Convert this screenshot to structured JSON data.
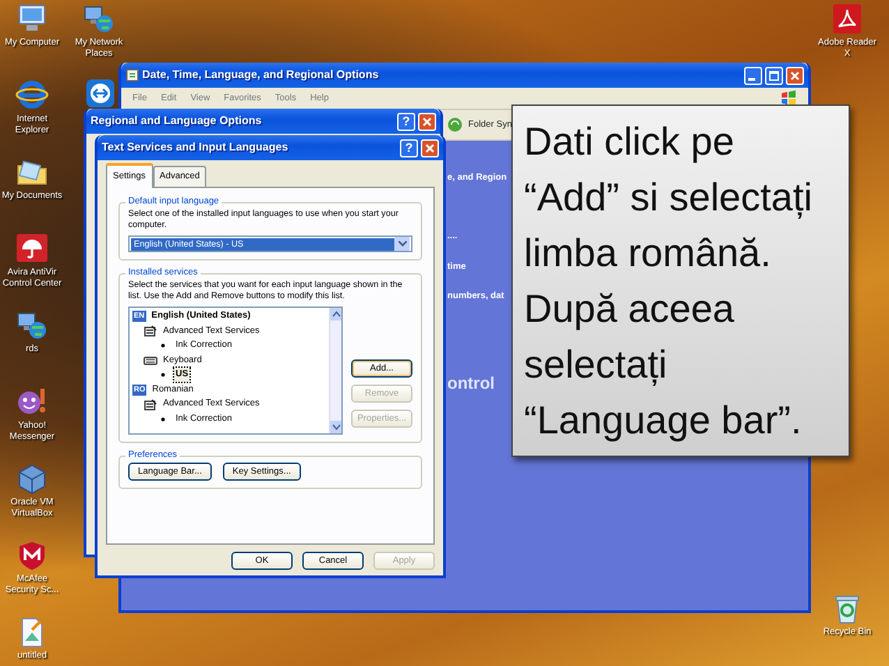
{
  "desktop": {
    "left_icons": [
      {
        "label": "My Computer",
        "kind": "computer"
      },
      {
        "label": "Internet Explorer",
        "kind": "browser"
      },
      {
        "label": "My Documents",
        "kind": "documents"
      },
      {
        "label": "Avira AntiVir Control Center",
        "kind": "avira"
      },
      {
        "label": "rds",
        "kind": "network"
      },
      {
        "label": "Yahoo! Messenger",
        "kind": "messenger"
      },
      {
        "label": "Oracle VM VirtualBox",
        "kind": "virtualbox"
      },
      {
        "label": "McAfee Security Sc...",
        "kind": "security"
      },
      {
        "label": "untitled",
        "kind": "image"
      }
    ],
    "second_icons": [
      {
        "label": "My Network Places",
        "kind": "network"
      },
      {
        "kind": "remote"
      }
    ],
    "right_icons": [
      {
        "label": "Adobe Reader X",
        "kind": "pdf"
      },
      {
        "label": "Recycle Bin",
        "kind": "recycle"
      }
    ]
  },
  "back_window": {
    "title": "Date, Time, Language, and Regional Options",
    "menu": [
      "File",
      "Edit",
      "View",
      "Favorites",
      "Tools",
      "Help"
    ],
    "toolbar_item": "Folder Syn",
    "panel_texts": [
      {
        "text": "e, and Region",
        "kind": "header"
      },
      {
        "text": "....",
        "kind": "task"
      },
      {
        "text": "time",
        "kind": "task"
      },
      {
        "text": "numbers, dat",
        "kind": "task"
      },
      {
        "text": "ontrol",
        "kind": "title"
      }
    ]
  },
  "regional_dialog": {
    "title": "Regional and Language Options",
    "help": "?"
  },
  "text_services_dialog": {
    "title": "Text Services and Input Languages",
    "help": "?",
    "tabs": [
      {
        "label": "Settings",
        "selected": true
      },
      {
        "label": "Advanced",
        "selected": false
      }
    ],
    "default_language": {
      "heading": "Default input language",
      "description": "Select one of the installed input languages to use when you start your computer.",
      "value": "English (United States) - US"
    },
    "installed_services": {
      "heading": "Installed services",
      "description": "Select the services that you want for each input language shown in the list. Use the Add and Remove buttons to modify this list.",
      "tree": [
        {
          "kind": "language",
          "badge": "EN",
          "label": "English (United States)",
          "default": true,
          "selected": false,
          "children": [
            {
              "kind": "services",
              "label": "Advanced Text Services",
              "selected": false,
              "children": [
                {
                  "kind": "item",
                  "label": "Ink Correction",
                  "selected": false
                }
              ]
            },
            {
              "kind": "keyboard",
              "label": "Keyboard",
              "selected": false,
              "children": [
                {
                  "kind": "item",
                  "label": "US",
                  "selected": true
                }
              ]
            }
          ]
        },
        {
          "kind": "language",
          "badge": "RO",
          "label": "Romanian",
          "default": false,
          "selected": false,
          "children": [
            {
              "kind": "services",
              "label": "Advanced Text Services",
              "selected": false,
              "children": [
                {
                  "kind": "item",
                  "label": "Ink Correction",
                  "selected": false
                }
              ]
            }
          ]
        }
      ],
      "buttons": [
        {
          "label": "Add...",
          "disabled": false,
          "focused": true
        },
        {
          "label": "Remove",
          "disabled": true,
          "focused": false
        },
        {
          "label": "Properties...",
          "disabled": true,
          "focused": false
        }
      ]
    },
    "preferences": {
      "heading": "Preferences",
      "buttons": [
        "Language Bar...",
        "Key Settings..."
      ]
    },
    "footer_buttons": [
      {
        "label": "OK",
        "disabled": false
      },
      {
        "label": "Cancel",
        "disabled": false
      },
      {
        "label": "Apply",
        "disabled": true
      }
    ]
  },
  "callout": {
    "text": "Dati click pe “Add” si selectați limba română. După aceea selectați “Language bar”."
  }
}
